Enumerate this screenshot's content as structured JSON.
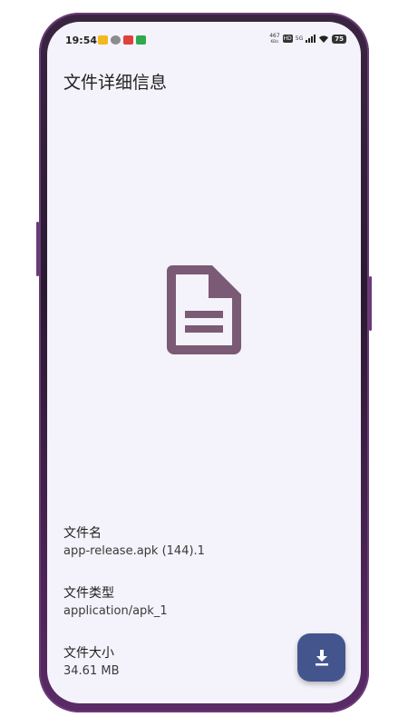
{
  "status_bar": {
    "time": "19:54",
    "net_speed_value": "467",
    "net_speed_unit": "KB/s",
    "hd_label": "HD",
    "network_label": "5G",
    "battery_level": "75",
    "notification_icons": [
      "app-notification-icon",
      "wechat-icon",
      "app-notification-icon",
      "app-notification-icon"
    ]
  },
  "header": {
    "title": "文件详细信息"
  },
  "file_preview": {
    "icon": "document-icon",
    "icon_color": "#7a5a74"
  },
  "details": {
    "name_label": "文件名",
    "name_value": "app-release.apk (144).1",
    "type_label": "文件类型",
    "type_value": "application/apk_1",
    "size_label": "文件大小",
    "size_value": "34.61 MB"
  },
  "actions": {
    "download_icon": "download-icon",
    "fab_color": "#44558e"
  },
  "colors": {
    "screen_background": "#f4f2fa",
    "phone_frame": "#5a2a66"
  }
}
